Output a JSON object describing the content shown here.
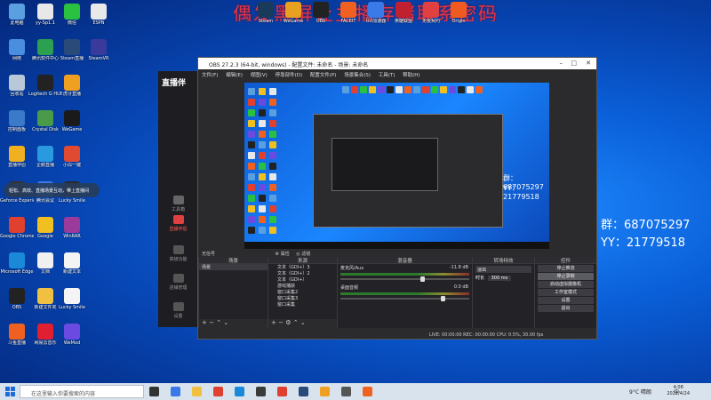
{
  "overlay": {
    "title": "偶发黑屏让主播存储联系密码",
    "group_text": "群：687075297",
    "yy_text": "YY：21779518"
  },
  "desktop_icons": [
    {
      "label": "此电脑",
      "color": "#5aa0e0"
    },
    {
      "label": "网络",
      "color": "#4a8ee0"
    },
    {
      "label": "回收站",
      "color": "#b8c8d8"
    },
    {
      "label": "控制面板",
      "color": "#3a7ac8"
    },
    {
      "label": "直播伴侣",
      "color": "#f0b020"
    },
    {
      "label": "Geforce Experience",
      "color": "#333"
    },
    {
      "label": "Google Chrome",
      "color": "#e04030"
    },
    {
      "label": "Microsoft Edge",
      "color": "#1a8ad8"
    },
    {
      "label": "OBS",
      "color": "#222"
    },
    {
      "label": "斗鱼直播",
      "color": "#f06020"
    },
    {
      "label": "yy-Sp1.1",
      "color": "#e8e8e8"
    },
    {
      "label": "腾讯软件中心",
      "color": "#2aa050"
    },
    {
      "label": "Logitech G HUB",
      "color": "#222"
    },
    {
      "label": "Crystal Disk",
      "color": "#4a9a4a"
    },
    {
      "label": "企鹅直播",
      "color": "#2a9ae0"
    },
    {
      "label": "腾讯会议",
      "color": "#3a7ae8"
    },
    {
      "label": "Google",
      "color": "#f0c020"
    },
    {
      "label": "文档",
      "color": "#f0f0f0"
    },
    {
      "label": "新建文件夹",
      "color": "#f0c040"
    },
    {
      "label": "网易云音乐",
      "color": "#e02030"
    },
    {
      "label": "微信",
      "color": "#2ac040"
    },
    {
      "label": "Steam直播",
      "color": "#2a4a7a"
    },
    {
      "label": "虎牙直播",
      "color": "#f0a020"
    },
    {
      "label": "WeGame",
      "color": "#1a1a1a"
    },
    {
      "label": "小白一键",
      "color": "#e04a30"
    },
    {
      "label": "Lucky Smile",
      "color": "#2a2a2a"
    },
    {
      "label": "WinRAR",
      "color": "#9a3a9a"
    },
    {
      "label": "新建文本",
      "color": "#f4f4f4"
    },
    {
      "label": "Lucky Smile",
      "color": "#f4f4f4"
    },
    {
      "label": "WeMod",
      "color": "#6a4ae0"
    },
    {
      "label": "ESPN",
      "color": "#e8e8e8"
    },
    {
      "label": "SteamVR",
      "color": "#3a3a9a"
    }
  ],
  "top_icons": [
    "Steam",
    "WeGame",
    "OBS",
    "FACEIT",
    "UU加速器",
    "英雄联盟",
    "无畏契约",
    "Origin"
  ],
  "tooltip": "轻松、高效、直播场景互动，带上直播间",
  "streaming_app": {
    "logo": "直播伴",
    "nav": [
      "工具箱",
      "直播伴侣",
      "高级功能",
      "店铺管理",
      "设置"
    ],
    "bottom_text": "立即更新伴侣"
  },
  "obs": {
    "title": "OBS 27.2.3 (64-bit, windows) - 配置文件: 未命名 - 场景: 未命名",
    "menu": [
      "文件(F)",
      "编辑(E)",
      "视图(V)",
      "停靠部件(D)",
      "配置文件(P)",
      "场景集合(S)",
      "工具(T)",
      "帮助(H)"
    ],
    "tabs": [
      "无信号",
      "属性",
      "滤镜"
    ],
    "docks": {
      "scenes": {
        "header": "场景",
        "items": [
          "场景"
        ]
      },
      "sources": {
        "header": "来源",
        "items": [
          "文本（GDI+）3",
          "文本（GDI+）2",
          "文本（GDI+）",
          "游戏捕获",
          "窗口采集2",
          "窗口采集3",
          "窗口采集"
        ]
      },
      "mixer": {
        "header": "混音器",
        "channels": [
          {
            "name": "麦克风/Aux",
            "db": "-11.8 dB",
            "level": 0.62
          },
          {
            "name": "桌面音频",
            "db": "0.0 dB",
            "level": 0.78
          }
        ]
      },
      "transitions": {
        "header": "转场特效",
        "fade": "淡出",
        "duration_label": "时长",
        "duration": "300 ms"
      },
      "controls": {
        "header": "控件",
        "buttons": [
          "停止推流",
          "停止录制",
          "启动虚拟摄像机",
          "工作室模式",
          "设置",
          "退出"
        ]
      }
    },
    "status": "LIVE: 00:00:00   REC: 00:00:00   CPU: 0.5%, 30.00 fps",
    "preview_label1": "群：687075297",
    "preview_label2": "YY：21779518"
  },
  "taskbar": {
    "search_placeholder": "在这里输入你要搜索的内容",
    "weather": "9°C 晴朗",
    "time": "4:08",
    "date": "2022/4/24",
    "lang": "中"
  }
}
